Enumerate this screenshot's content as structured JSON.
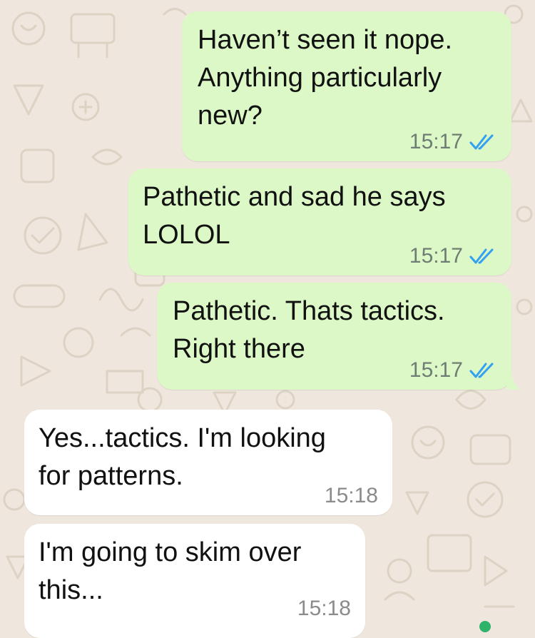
{
  "messages": [
    {
      "direction": "outgoing",
      "text": "Haven’t seen it nope.\nAnything particularly\nnew?",
      "time": "15:17",
      "status": "read"
    },
    {
      "direction": "outgoing",
      "text": "Pathetic and sad he says\nLOLOL",
      "time": "15:17",
      "status": "read"
    },
    {
      "direction": "outgoing",
      "text": "Pathetic. Thats tactics.\nRight there",
      "time": "15:17",
      "status": "read"
    },
    {
      "direction": "incoming",
      "text": "Yes...tactics. I'm looking\nfor patterns.",
      "time": "15:18"
    },
    {
      "direction": "incoming",
      "text": "I'm going to skim over\nthis...",
      "time": "15:18"
    }
  ],
  "colors": {
    "outgoing_bubble": "#dcf8c6",
    "incoming_bubble": "#ffffff",
    "read_ticks": "#34a0f0",
    "wallpaper": "#efe7dd"
  },
  "icons": {
    "read_receipt": "double-check-icon"
  }
}
